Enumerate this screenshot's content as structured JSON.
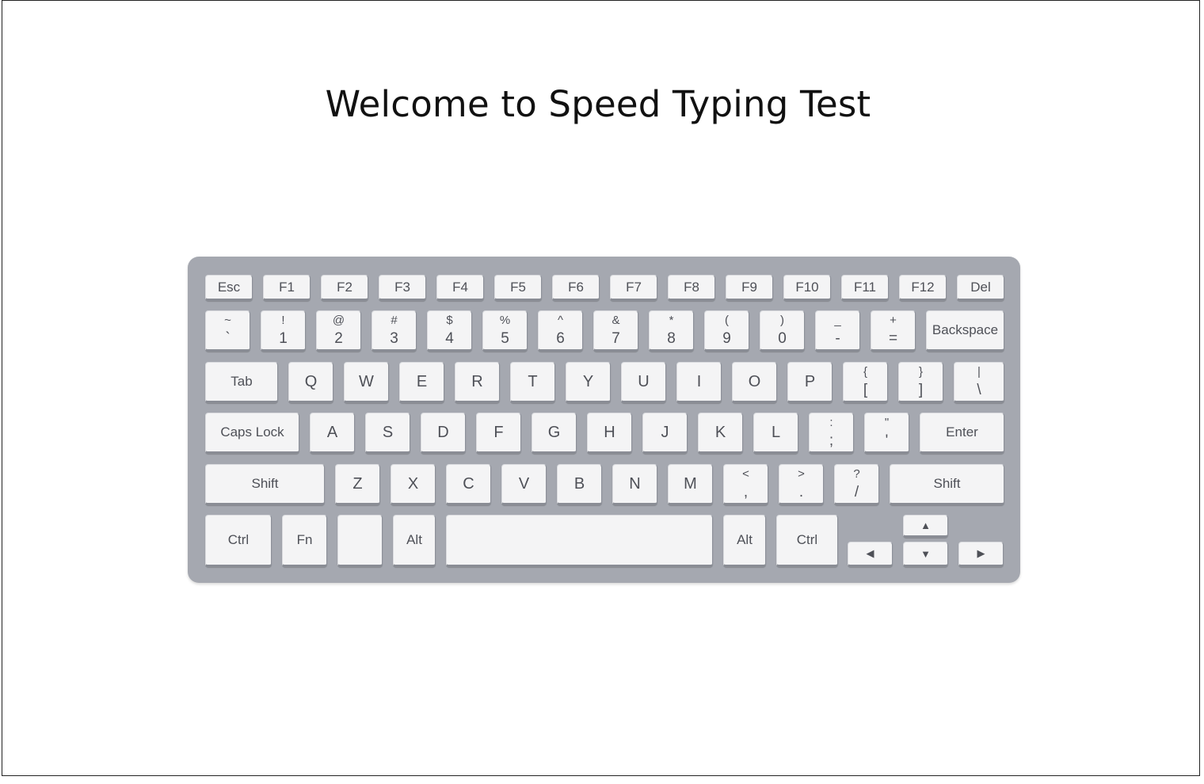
{
  "page": {
    "title": "Welcome to Speed Typing Test"
  },
  "keyboard": {
    "row_function": [
      "Esc",
      "F1",
      "F2",
      "F3",
      "F4",
      "F5",
      "F6",
      "F7",
      "F8",
      "F9",
      "F10",
      "F11",
      "F12",
      "Del"
    ],
    "row_number": [
      {
        "top": "~",
        "bottom": "`"
      },
      {
        "top": "!",
        "bottom": "1"
      },
      {
        "top": "@",
        "bottom": "2"
      },
      {
        "top": "#",
        "bottom": "3"
      },
      {
        "top": "$",
        "bottom": "4"
      },
      {
        "top": "%",
        "bottom": "5"
      },
      {
        "top": "^",
        "bottom": "6"
      },
      {
        "top": "&",
        "bottom": "7"
      },
      {
        "top": "*",
        "bottom": "8"
      },
      {
        "top": "(",
        "bottom": "9"
      },
      {
        "top": ")",
        "bottom": "0"
      },
      {
        "top": "_",
        "bottom": "-"
      },
      {
        "top": "+",
        "bottom": "="
      }
    ],
    "backspace": "Backspace",
    "tab": "Tab",
    "row_qwerty": [
      "Q",
      "W",
      "E",
      "R",
      "T",
      "Y",
      "U",
      "I",
      "O",
      "P"
    ],
    "row_qwerty_symbols": [
      {
        "top": "{",
        "bottom": "["
      },
      {
        "top": "}",
        "bottom": "]"
      },
      {
        "top": "|",
        "bottom": "\\"
      }
    ],
    "caps_lock": "Caps Lock",
    "row_home": [
      "A",
      "S",
      "D",
      "F",
      "G",
      "H",
      "J",
      "K",
      "L"
    ],
    "row_home_symbols": [
      {
        "top": ":",
        "bottom": ";"
      },
      {
        "top": "\"",
        "bottom": "'"
      }
    ],
    "enter": "Enter",
    "shift_left": "Shift",
    "row_bottom": [
      "Z",
      "X",
      "C",
      "V",
      "B",
      "N",
      "M"
    ],
    "row_bottom_symbols": [
      {
        "top": "<",
        "bottom": ","
      },
      {
        "top": ">",
        "bottom": "."
      },
      {
        "top": "?",
        "bottom": "/"
      }
    ],
    "shift_right": "Shift",
    "ctrl_left": "Ctrl",
    "fn": "Fn",
    "blank": "",
    "alt_left": "Alt",
    "space": "",
    "alt_right": "Alt",
    "ctrl_right": "Ctrl",
    "arrows": {
      "up": "▲",
      "left": "◀",
      "down": "▼",
      "right": "▶"
    }
  },
  "colors": {
    "keyboard_body": "#a5a8b0",
    "key_face": "#f4f4f5",
    "key_text": "#4e5057",
    "title_text": "#111111"
  }
}
